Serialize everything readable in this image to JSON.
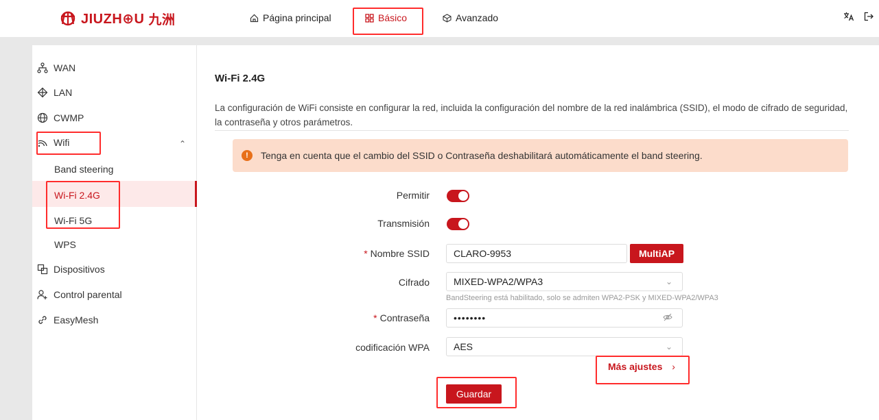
{
  "brand": {
    "name": "JIUZH⊕U",
    "name_cn": "九洲",
    "color": "#c8161d"
  },
  "nav": {
    "home_label": "Página principal",
    "basic_label": "Básico",
    "advanced_label": "Avanzado"
  },
  "sidebar": {
    "items": [
      {
        "label": "WAN",
        "icon": "network-icon"
      },
      {
        "label": "LAN",
        "icon": "lan-icon"
      },
      {
        "label": "CWMP",
        "icon": "globe-icon"
      },
      {
        "label": "Wifi",
        "icon": "wifi-icon"
      },
      {
        "label": "Dispositivos",
        "icon": "devices-icon"
      },
      {
        "label": "Control parental",
        "icon": "parental-icon"
      },
      {
        "label": "EasyMesh",
        "icon": "link-icon"
      }
    ],
    "wifi_sub": [
      "Band steering",
      "Wi-Fi 2.4G",
      "Wi-Fi 5G",
      "WPS"
    ]
  },
  "main": {
    "title": "Wi-Fi 2.4G",
    "description": "La configuración de WiFi consiste en configurar la red, incluida la configuración del nombre de la red inalámbrica (SSID), el modo de cifrado de seguridad, la contraseña y otros parámetros.",
    "notice": "Tenga en cuenta que el cambio del SSID o Contraseña deshabilitará automáticamente el band steering.",
    "notice_icon": "!",
    "form": {
      "permitir_label": "Permitir",
      "transmision_label": "Transmisión",
      "ssid_label": "Nombre SSID",
      "ssid_value": "CLARO-9953",
      "multiap_label": "MultiAP",
      "cifrado_label": "Cifrado",
      "cifrado_value": "MIXED-WPA2/WPA3",
      "cifrado_hint": "BandSteering está habilitado, solo se admiten WPA2-PSK y MIXED-WPA2/WPA3",
      "password_label": "Contraseña",
      "password_value": "••••••••",
      "wpa_label": "codificación WPA",
      "wpa_value": "AES",
      "required_mark": "*"
    },
    "more_settings_label": "Más ajustes",
    "save_label": "Guardar"
  },
  "colors": {
    "accent": "#c8161d",
    "notice_bg": "#fcdccb",
    "highlight": "#ff2b2b"
  }
}
